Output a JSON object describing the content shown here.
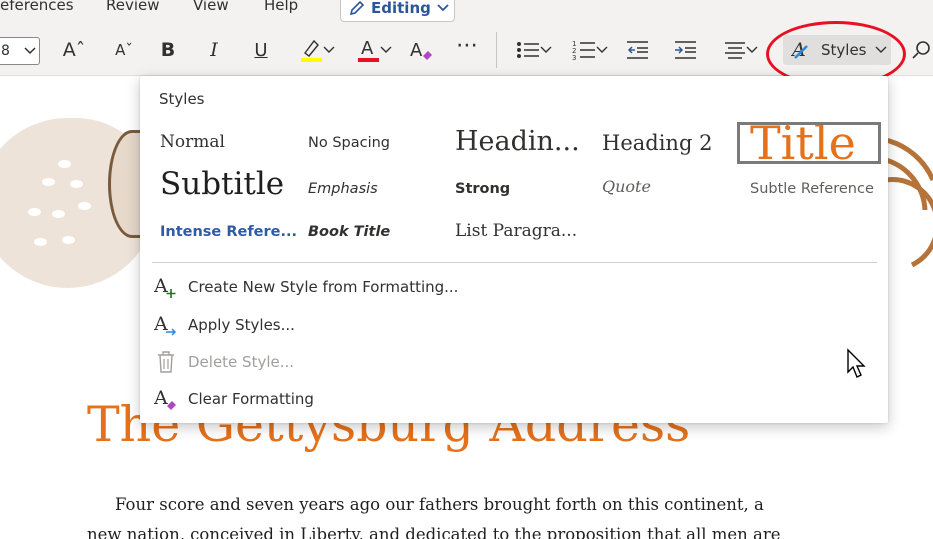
{
  "menu": {
    "references": "eferences",
    "review": "Review",
    "view": "View",
    "help": "Help",
    "editing": "Editing"
  },
  "toolbar": {
    "font_size": "8",
    "styles_label": "Styles",
    "highlight_color": "#ffff00",
    "font_color": "#e81123"
  },
  "styles_panel": {
    "header": "Styles",
    "tiles": {
      "normal": "Normal",
      "no_spacing": "No Spacing",
      "heading1": "Headin...",
      "heading2": "Heading 2",
      "title": "Title",
      "subtitle": "Subtitle",
      "emphasis": "Emphasis",
      "strong": "Strong",
      "quote": "Quote",
      "subtle_reference": "Subtle Reference",
      "intense_reference": "Intense Refere...",
      "book_title": "Book Title",
      "list_paragraph": "List Paragra..."
    },
    "commands": {
      "create": "Create New Style from Formatting...",
      "apply": "Apply Styles...",
      "delete": "Delete Style...",
      "clear": "Clear Formatting"
    }
  },
  "document": {
    "title": "The Gettysburg Address",
    "para_line1": "Four score and seven years ago our fathers brought forth on this continent, a",
    "para_line2": "new nation, conceived in Liberty, and dedicated to the proposition that all men are"
  },
  "colors": {
    "accent_orange": "#e5711b",
    "word_blue": "#2b579a",
    "annotation_red": "#e81123"
  }
}
